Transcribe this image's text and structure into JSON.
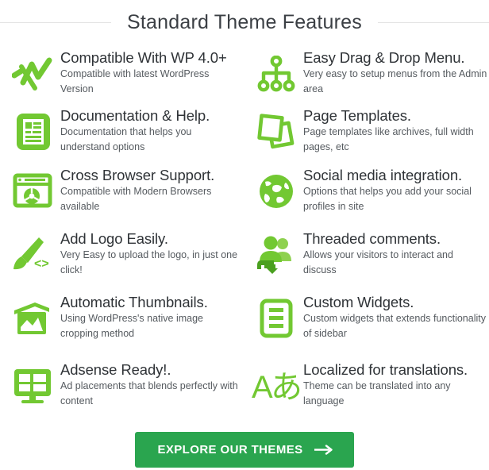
{
  "header": {
    "title": "Standard Theme Features",
    "divider_color": "#e3e3e3"
  },
  "theme": {
    "icon_green": "#72c832",
    "button_green": "#2aa54f",
    "title_color": "#2f3337",
    "body_color": "#555a5f"
  },
  "features": [
    {
      "icon": "line-chart-icon",
      "title": "Compatible With WP 4.0+",
      "description": "Compatible with latest WordPress Version"
    },
    {
      "icon": "sitemap-icon",
      "title": "Easy Drag & Drop Menu.",
      "description": "Very easy to setup menus from the Admin area"
    },
    {
      "icon": "document-icon",
      "title": "Documentation & Help.",
      "description": "Documentation that helps you understand options"
    },
    {
      "icon": "pages-stack-icon",
      "title": "Page Templates.",
      "description": "Page templates like archives, full width pages, etc"
    },
    {
      "icon": "browser-window-icon",
      "title": "Cross Browser Support.",
      "description": "Compatible with Modern Browsers available"
    },
    {
      "icon": "globe-icon",
      "title": "Social media integration.",
      "description": "Options that helps you add your social profiles in site"
    },
    {
      "icon": "paintbrush-code-icon",
      "title": "Add Logo Easily.",
      "description": "Very Easy to upload the logo, in just one click!"
    },
    {
      "icon": "users-reply-icon",
      "title": "Threaded comments.",
      "description": "Allows your visitors to interact and discuss"
    },
    {
      "icon": "images-stack-icon",
      "title": "Automatic Thumbnails.",
      "description": "Using WordPress's native image cropping method"
    },
    {
      "icon": "widget-list-icon",
      "title": "Custom Widgets.",
      "description": "Custom widgets that extends functionality of sidebar"
    },
    {
      "icon": "monitor-grid-icon",
      "title": "Adsense Ready!.",
      "description": "Ad placements that blends perfectly with content"
    },
    {
      "icon": "translate-icon",
      "title": "Localized for translations.",
      "description": "Theme can be translated into any language"
    }
  ],
  "cta": {
    "label": "EXPLORE OUR THEMES",
    "arrow_icon": "arrow-right-icon"
  }
}
